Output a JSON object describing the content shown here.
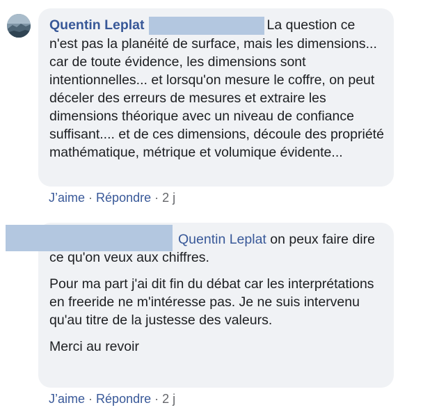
{
  "comment1": {
    "author": "Quentin Leplat",
    "text": "La question ce n'est pas la planéité de surface, mais les dimensions... car de toute évidence, les dimensions sont intentionnelles... et lorsqu'on mesure le coffre, on peut déceler des erreurs de mesures et extraire les dimensions théorique avec un niveau de confiance suffisant.... et de ces dimensions, découle des propriété mathématique, métrique et volumique évidente...",
    "like_label": "J’aime",
    "reply_label": "Répondre",
    "separator": "·",
    "time": "2 j"
  },
  "comment2": {
    "mention": "Quentin Leplat",
    "text_line1": "on peux faire dire ce qu'on veux aux chiffres.",
    "para2": "Pour ma part j'ai dit fin du débat car les interprétations en freeride ne m'intéresse pas. Je ne suis intervenu qu'au titre de la justesse des valeurs.",
    "para3": "Merci au revoir",
    "like_label": "J’aime",
    "reply_label": "Répondre",
    "separator": "·",
    "time": "2 j"
  },
  "colors": {
    "link": "#385898",
    "bubble": "#f0f2f5",
    "redaction": "#b3c7e0"
  }
}
